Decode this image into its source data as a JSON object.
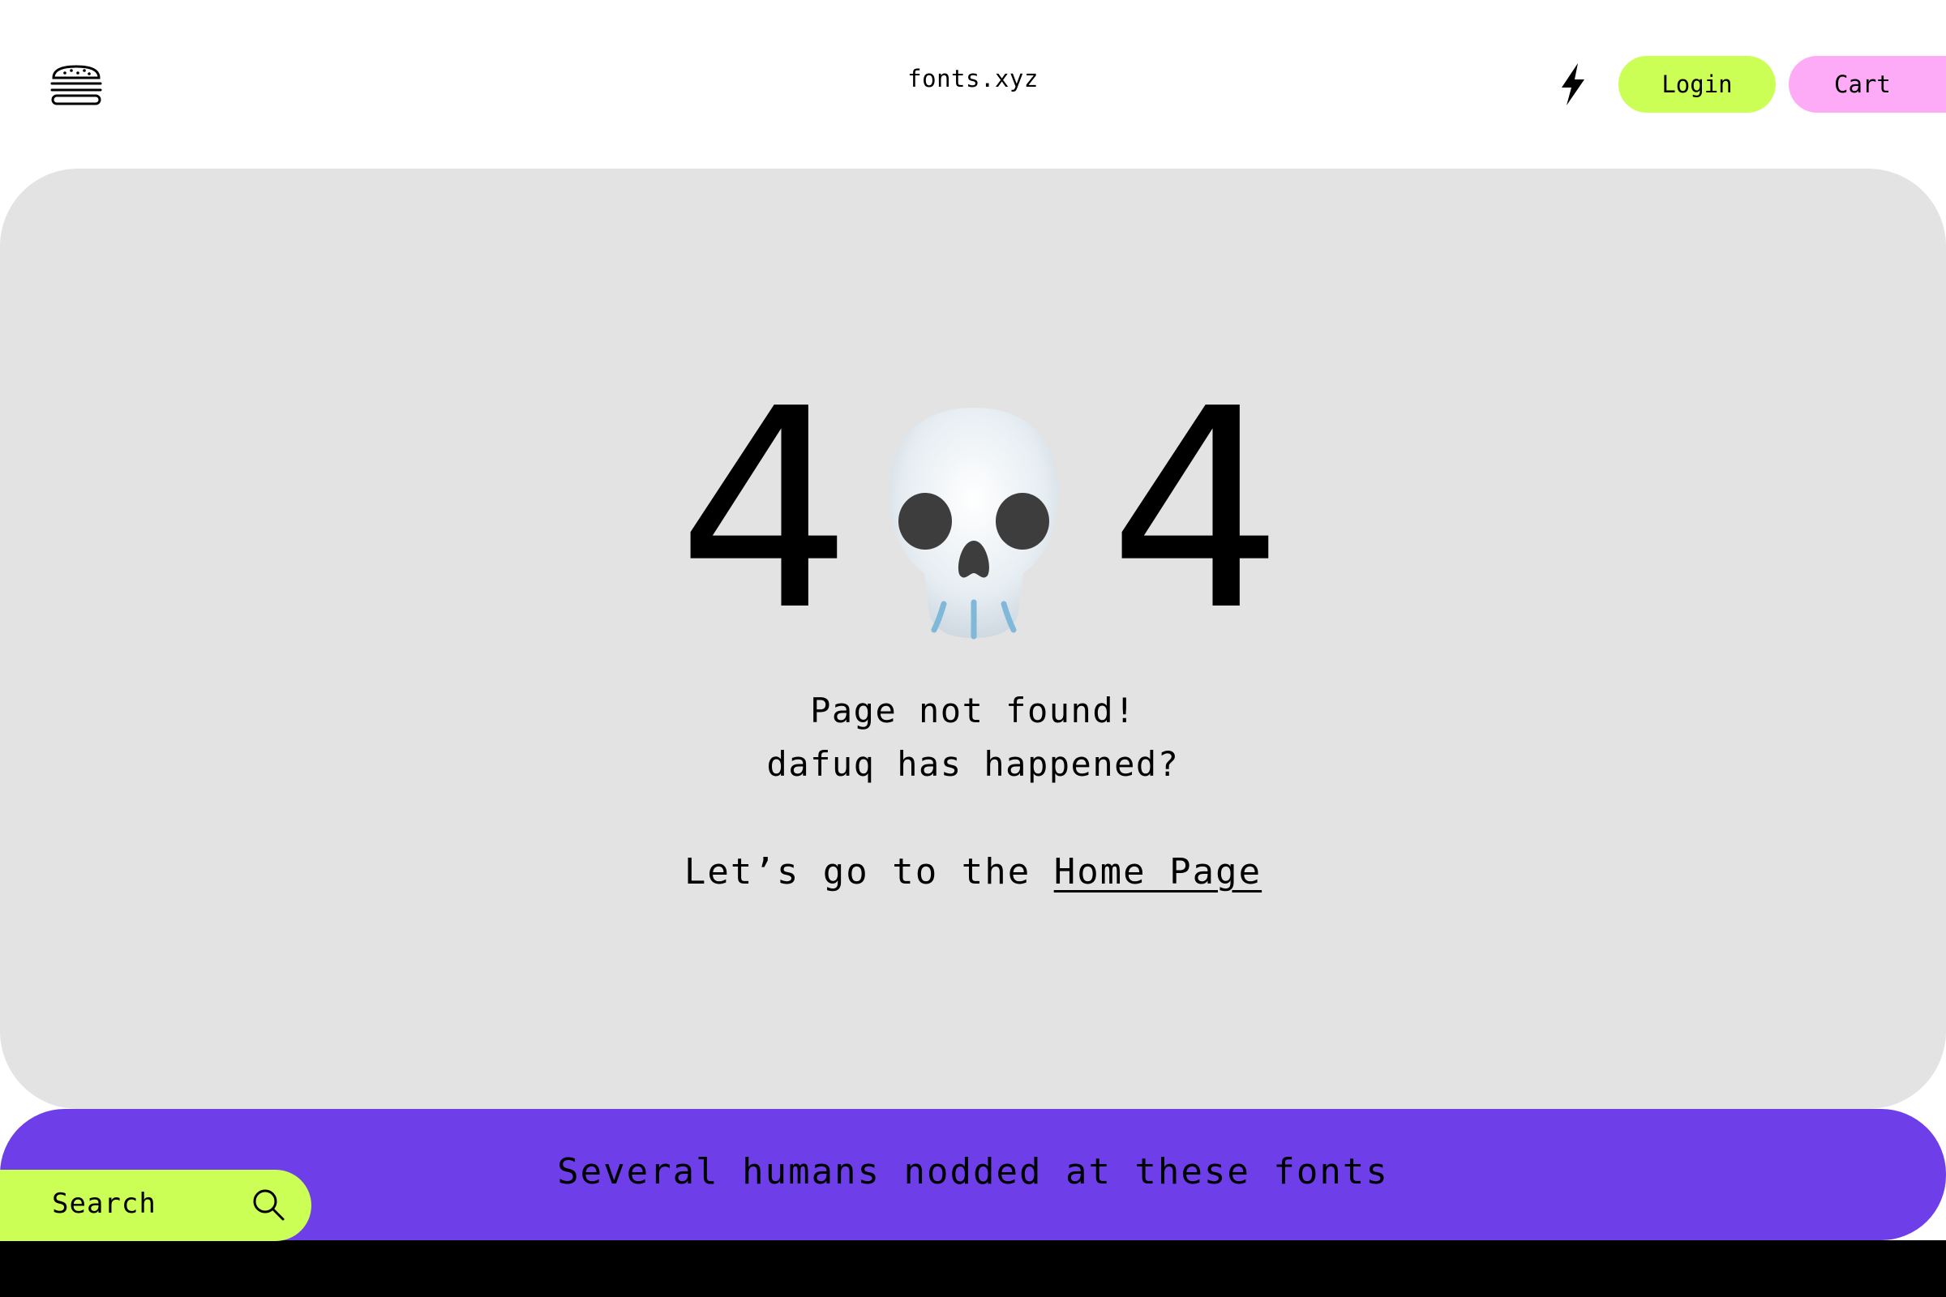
{
  "header": {
    "logo": "fonts.xyz",
    "menu_icon": "burger-menu-icon",
    "bolt_icon": "lightning-bolt-icon",
    "login_label": "Login",
    "cart_label": "Cart"
  },
  "main": {
    "digit_left": "4",
    "digit_right": "4",
    "skull_icon": "skull-icon",
    "message_line1": "Page not found!",
    "message_line2": "dafuq has happened?",
    "home_prefix": "Let’s go to the ",
    "home_link": "Home Page"
  },
  "banner": {
    "text": "Several humans nodded at these fonts"
  },
  "search": {
    "label": "Search",
    "icon": "search-icon"
  },
  "colors": {
    "accent_green": "#ccff55",
    "accent_pink": "#fdaaf7",
    "banner_purple": "#6e3ee8",
    "card_gray": "#e3e3e3"
  }
}
